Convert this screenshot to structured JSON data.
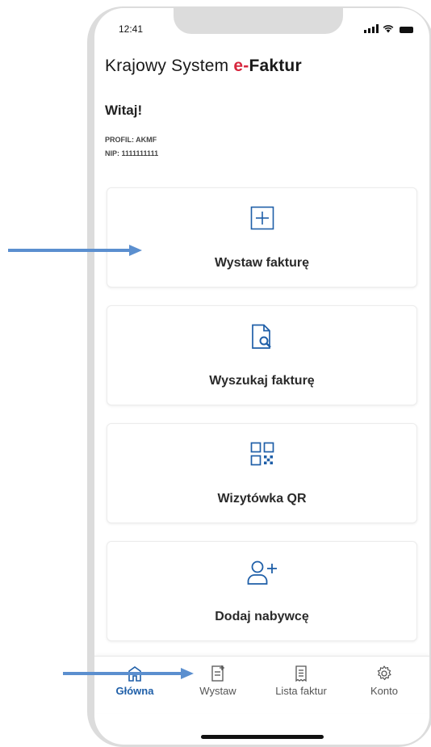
{
  "status_bar": {
    "time": "12:41"
  },
  "header": {
    "title_prefix": "Krajowy System ",
    "title_accent": "e-",
    "title_bold": "Faktur"
  },
  "greeting": "Witaj!",
  "profile": {
    "profile_line": "PROFIL: AKMF",
    "nip_line": "NIP: 1111111111"
  },
  "actions": [
    {
      "label": "Wystaw fakturę",
      "icon": "plus-square-icon"
    },
    {
      "label": "Wyszukaj fakturę",
      "icon": "document-search-icon"
    },
    {
      "label": "Wizytówka QR",
      "icon": "qr-code-icon"
    },
    {
      "label": "Dodaj nabywcę",
      "icon": "add-user-icon"
    }
  ],
  "bottom_nav": [
    {
      "label": "Główna",
      "icon": "home-icon",
      "active": true
    },
    {
      "label": "Wystaw",
      "icon": "add-document-icon",
      "active": false
    },
    {
      "label": "Lista faktur",
      "icon": "list-document-icon",
      "active": false
    },
    {
      "label": "Konto",
      "icon": "gear-icon",
      "active": false
    }
  ],
  "colors": {
    "accent_red": "#d7263d",
    "nav_active": "#1f5fa8",
    "icon_blue": "#1f5fa8",
    "arrow_blue": "#5b8fcf"
  }
}
